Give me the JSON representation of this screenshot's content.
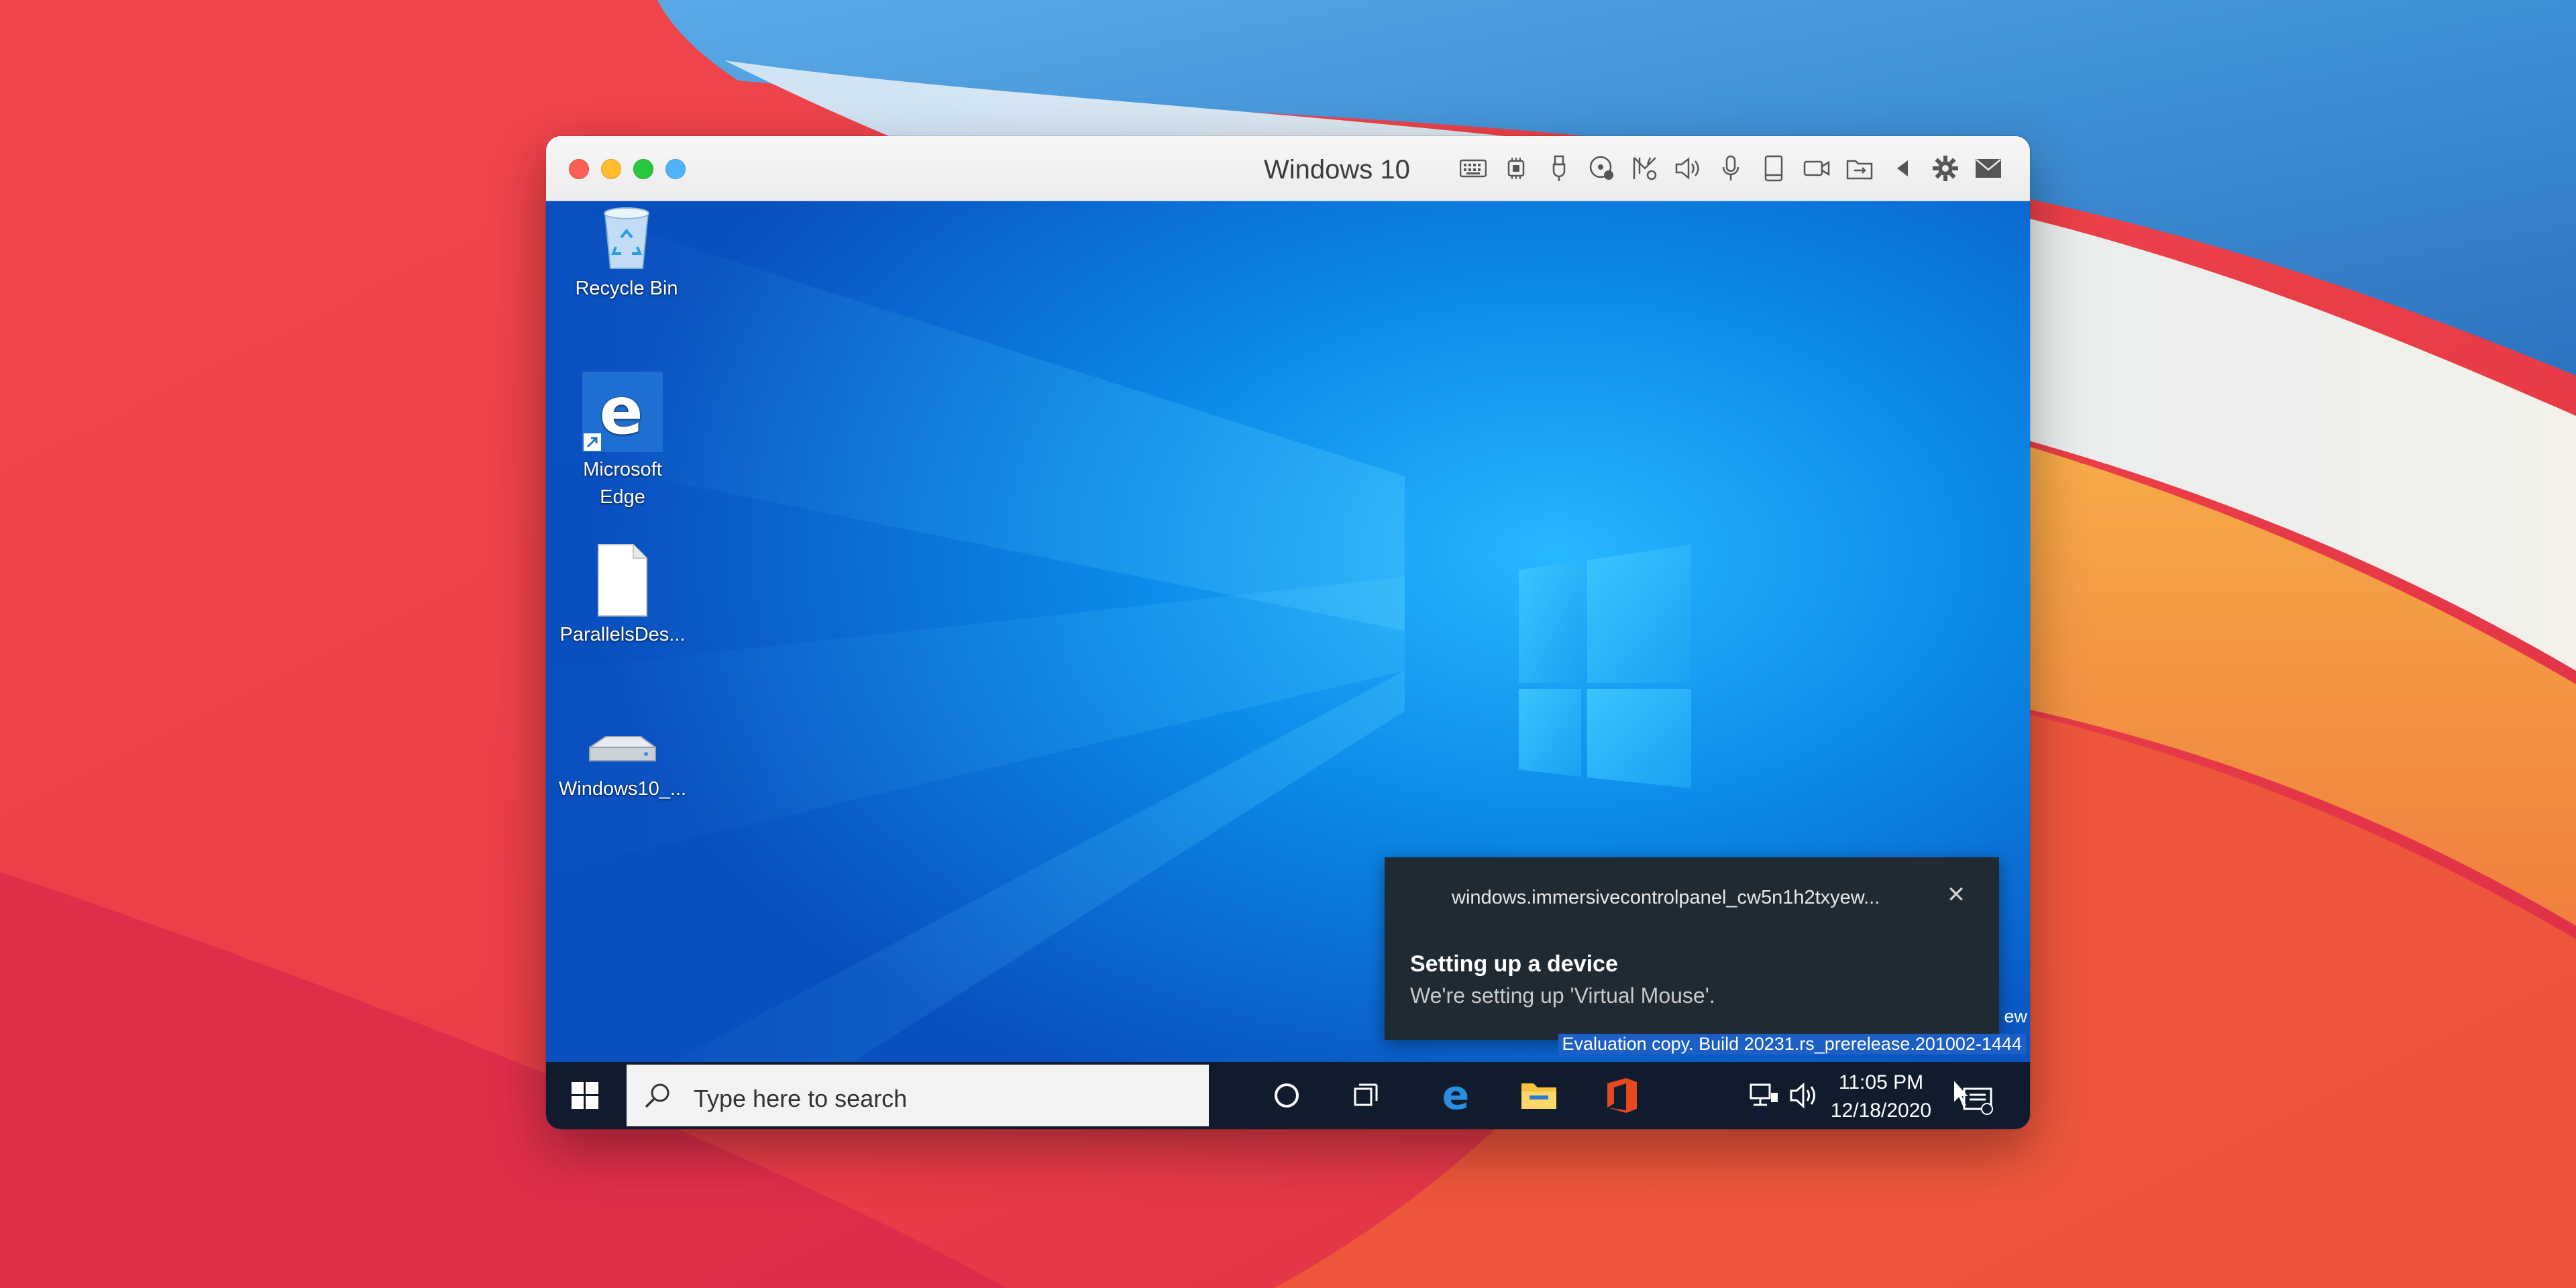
{
  "vm_window": {
    "title": "Windows 10",
    "toolbar_icons": [
      "keyboard-icon",
      "cpu-icon",
      "usb-icon",
      "cd-icon",
      "network-icon",
      "sound-icon",
      "microphone-icon",
      "hard-disk-icon",
      "camera-icon",
      "shared-folder-icon",
      "back-icon",
      "gear-icon",
      "envelope-icon"
    ]
  },
  "desktop": {
    "icons": [
      {
        "label": "Recycle Bin",
        "icon": "recycle-bin-icon"
      },
      {
        "label": "Microsoft Edge",
        "icon": "edge-icon"
      },
      {
        "label": "ParallelsDes...",
        "icon": "document-icon"
      },
      {
        "label": "Windows10_...",
        "icon": "drive-icon"
      }
    ],
    "watermark_partial": "ew",
    "watermark": "Evaluation copy. Build 20231.rs_prerelease.201002-1444"
  },
  "notification": {
    "app": "windows.immersivecontrolpanel_cw5n1h2txyew...",
    "title": "Setting up a device",
    "body": "We're setting up 'Virtual Mouse'."
  },
  "taskbar": {
    "search_placeholder": "Type here to search",
    "apps": [
      "cortana-icon",
      "task-view-icon",
      "edge-icon",
      "file-explorer-icon",
      "office-icon"
    ],
    "time": "11:05 PM",
    "date": "12/18/2020"
  },
  "colors": {
    "accent": "#0a74d8",
    "taskbar": "#101c2e",
    "toast": "#1f2a33"
  }
}
